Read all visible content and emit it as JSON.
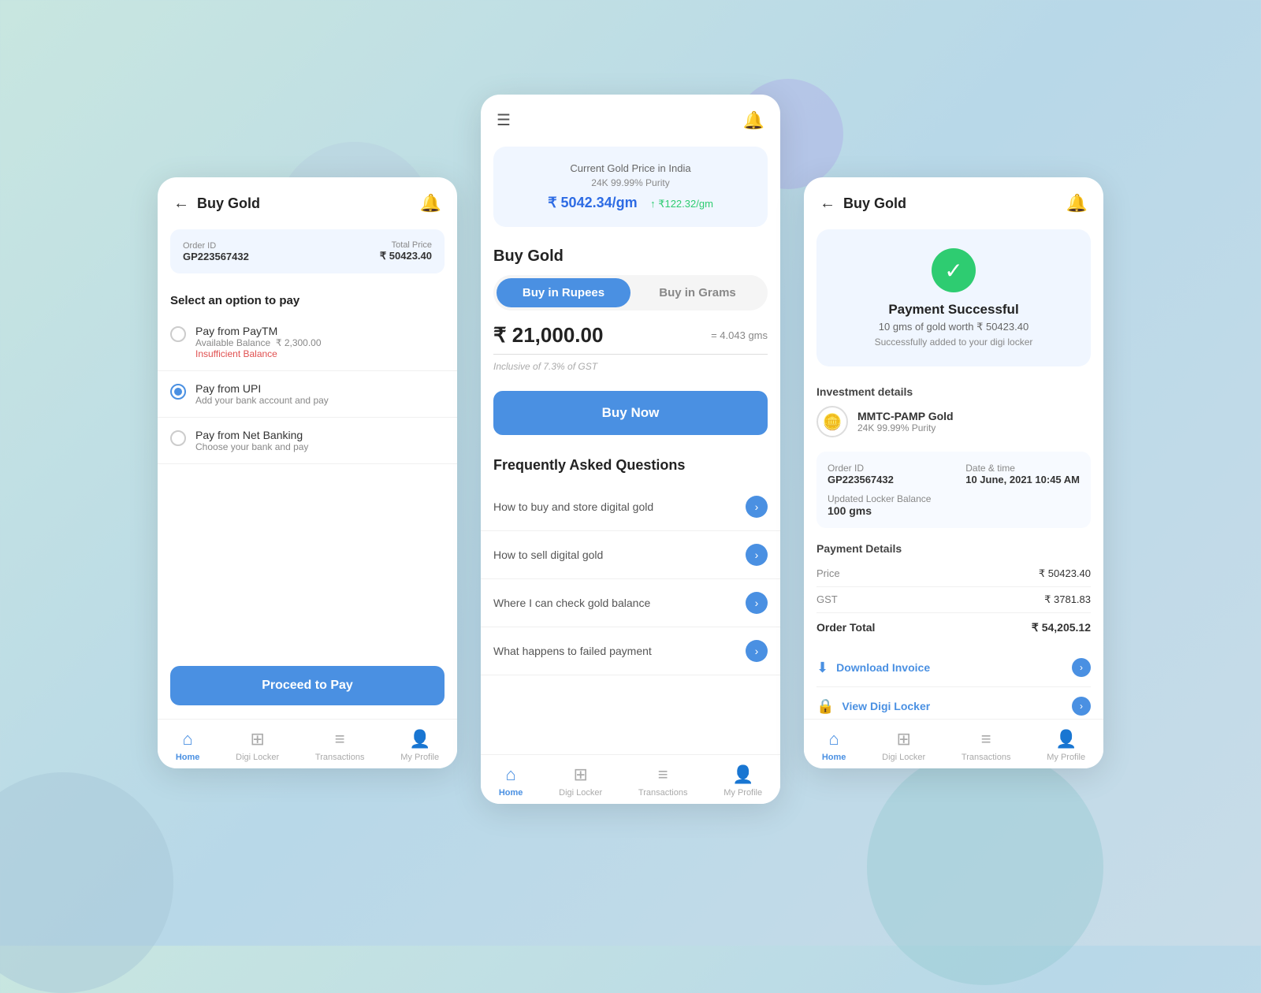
{
  "background": {
    "color": "#b8d8e8"
  },
  "screen1": {
    "title": "Buy Gold",
    "order_label": "Order ID",
    "order_id": "GP223567432",
    "total_price_label": "Total Price",
    "total_price": "₹ 50423.40",
    "select_option_label": "Select an option to pay",
    "payment_options": [
      {
        "name": "Pay from PayTM",
        "sub": "Available Balance  ₹ 2,300.00",
        "note": "Insufficient Balance",
        "selected": false
      },
      {
        "name": "Pay from UPI",
        "sub": "Add your bank account and pay",
        "note": "",
        "selected": true
      },
      {
        "name": "Pay from Net Banking",
        "sub": "Choose your bank and pay",
        "note": "",
        "selected": false
      }
    ],
    "proceed_btn": "Proceed to Pay",
    "nav": {
      "home": "Home",
      "digi_locker": "Digi Locker",
      "transactions": "Transactions",
      "my_profile": "My Profile"
    }
  },
  "screen2": {
    "gold_price_title": "Current Gold Price in India",
    "gold_purity": "24K 99.99% Purity",
    "gold_price": "₹ 5042.34/gm",
    "gold_change": "↑ ₹122.32/gm",
    "buy_gold_title": "Buy Gold",
    "toggle_rupees": "Buy in Rupees",
    "toggle_grams": "Buy in Grams",
    "amount": "₹ 21,000.00",
    "grams": "= 4.043 gms",
    "gst_note": "Inclusive of 7.3% of GST",
    "buy_now_btn": "Buy Now",
    "faq_title": "Frequently Asked Questions",
    "faqs": [
      {
        "text": "How to buy and store digital gold"
      },
      {
        "text": "How to sell digital gold"
      },
      {
        "text": "Where I can check gold balance"
      },
      {
        "text": "What happens to failed payment"
      }
    ],
    "nav": {
      "home": "Home",
      "digi_locker": "Digi Locker",
      "transactions": "Transactions",
      "my_profile": "My Profile"
    }
  },
  "screen3": {
    "title": "Buy Gold",
    "success_title": "Payment Successful",
    "success_sub": "10 gms of gold worth ₹ 50423.40",
    "success_note": "Successfully added to your digi locker",
    "investment_title": "Investment details",
    "investment_name": "MMTC-PAMP Gold",
    "investment_purity": "24K 99.99% Purity",
    "order_id_label": "Order ID",
    "order_id": "GP223567432",
    "date_label": "Date & time",
    "date_value": "10 June, 2021 10:45 AM",
    "locker_balance_label": "Updated Locker Balance",
    "locker_balance": "100 gms",
    "payment_details_title": "Payment Details",
    "price_label": "Price",
    "price_value": "₹ 50423.40",
    "gst_label": "GST",
    "gst_value": "₹ 3781.83",
    "order_total_label": "Order Total",
    "order_total": "₹ 54,205.12",
    "download_invoice": "Download Invoice",
    "view_digi_locker": "View Digi Locker",
    "nav": {
      "home": "Home",
      "digi_locker": "Digi Locker",
      "transactions": "Transactions",
      "my_profile": "My Profile"
    }
  }
}
